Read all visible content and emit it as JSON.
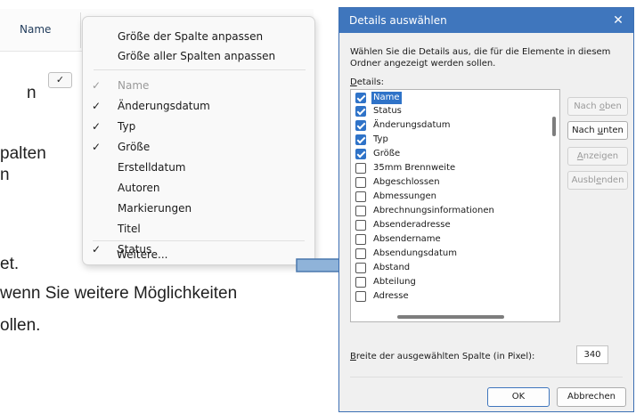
{
  "background_text": {
    "line1": "n",
    "line2": "palten",
    "line3": "n",
    "line4": "et.",
    "line5": "wenn Sie weitere Möglichkeiten",
    "line6": "ollen."
  },
  "explorer": {
    "column_header": "Name",
    "checkbox_mark": "✓"
  },
  "context_menu": {
    "items": [
      {
        "label": "Größe der Spalte anpassen",
        "check": ""
      },
      {
        "label": "Größe aller Spalten anpassen",
        "check": ""
      },
      {
        "label": "Name",
        "check": "✓"
      },
      {
        "label": "Änderungsdatum",
        "check": "✓"
      },
      {
        "label": "Typ",
        "check": "✓"
      },
      {
        "label": "Größe",
        "check": "✓"
      },
      {
        "label": "Erstelldatum",
        "check": ""
      },
      {
        "label": "Autoren",
        "check": ""
      },
      {
        "label": "Markierungen",
        "check": ""
      },
      {
        "label": "Titel",
        "check": ""
      },
      {
        "label": "Status",
        "check": "✓"
      },
      {
        "label": "Weitere...",
        "check": ""
      }
    ]
  },
  "dialog": {
    "title": "Details auswählen",
    "close_glyph": "✕",
    "instruction": "Wählen Sie die Details aus, die für die Elemente in diesem Ordner angezeigt werden sollen.",
    "details_label_prefix": "D",
    "details_label_rest": "etails:",
    "items": [
      {
        "label": "Name",
        "checked": true,
        "selected": true
      },
      {
        "label": "Status",
        "checked": true,
        "selected": false
      },
      {
        "label": "Änderungsdatum",
        "checked": true,
        "selected": false
      },
      {
        "label": "Typ",
        "checked": true,
        "selected": false
      },
      {
        "label": "Größe",
        "checked": true,
        "selected": false
      },
      {
        "label": "35mm Brennweite",
        "checked": false,
        "selected": false
      },
      {
        "label": "Abgeschlossen",
        "checked": false,
        "selected": false
      },
      {
        "label": "Abmessungen",
        "checked": false,
        "selected": false
      },
      {
        "label": "Abrechnungsinformationen",
        "checked": false,
        "selected": false
      },
      {
        "label": "Absenderadresse",
        "checked": false,
        "selected": false
      },
      {
        "label": "Absendername",
        "checked": false,
        "selected": false
      },
      {
        "label": "Absendungsdatum",
        "checked": false,
        "selected": false
      },
      {
        "label": "Abstand",
        "checked": false,
        "selected": false
      },
      {
        "label": "Abteilung",
        "checked": false,
        "selected": false
      },
      {
        "label": "Adresse",
        "checked": false,
        "selected": false
      }
    ],
    "buttons": {
      "move_up": {
        "pre": "Nach ",
        "key": "o",
        "post": "ben"
      },
      "move_down": {
        "pre": "Nach ",
        "key": "u",
        "post": "nten"
      },
      "show": {
        "pre": "",
        "key": "A",
        "post": "nzeigen"
      },
      "hide": {
        "pre": "Ausbl",
        "key": "e",
        "post": "nden"
      }
    },
    "width_label_key": "B",
    "width_label_rest": "reite der ausgewählten Spalte (in Pixel):",
    "width_value": "340",
    "ok_label": "OK",
    "cancel_label": "Abbrechen"
  },
  "colors": {
    "titlebar": "#3f76bd",
    "checkbox_checked": "#2f73c8",
    "arrow_fill": "#8fb3d9",
    "arrow_stroke": "#4a78ad"
  }
}
